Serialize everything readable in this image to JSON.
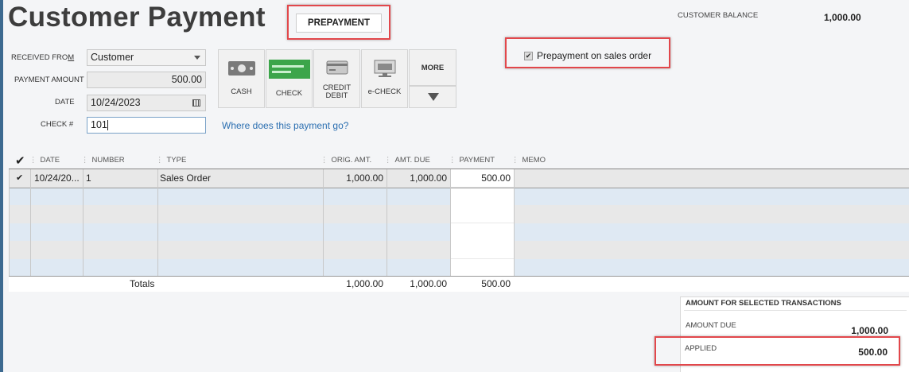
{
  "window": {
    "title": "Customer Payment"
  },
  "prepayment_button": "PREPAYMENT",
  "customer_balance": {
    "label": "CUSTOMER BALANCE",
    "value": "1,000.00"
  },
  "form": {
    "received_from": {
      "label": "RECEIVED FROM",
      "value": "Customer"
    },
    "payment_amount": {
      "label": "PAYMENT AMOUNT",
      "value": "500.00"
    },
    "date": {
      "label": "DATE",
      "value": "10/24/2023"
    },
    "check_no": {
      "label": "CHECK #",
      "value": "101"
    }
  },
  "payment_methods": [
    {
      "label": "CASH",
      "icon": "cash-icon"
    },
    {
      "label": "CHECK",
      "icon": "check-icon"
    },
    {
      "label": "CREDIT DEBIT",
      "icon": "credit-card-icon"
    },
    {
      "label": "e-CHECK",
      "icon": "echeck-icon"
    }
  ],
  "more_button": "MORE",
  "help_link": "Where does this payment go?",
  "prepayment_sales_order": {
    "label": "Prepayment on sales order",
    "checked": true
  },
  "table": {
    "columns": [
      "✔",
      "DATE",
      "NUMBER",
      "TYPE",
      "ORIG. AMT.",
      "AMT. DUE",
      "PAYMENT",
      "MEMO"
    ],
    "rows": [
      {
        "check": "✔",
        "date": "10/24/20...",
        "number": "1",
        "type": "Sales Order",
        "orig_amt": "1,000.00",
        "amt_due": "1,000.00",
        "payment": "500.00",
        "memo": ""
      }
    ],
    "totals": {
      "label": "Totals",
      "orig_amt": "1,000.00",
      "amt_due": "1,000.00",
      "payment": "500.00"
    }
  },
  "summary": {
    "title": "AMOUNT FOR SELECTED TRANSACTIONS",
    "amount_due": {
      "label": "AMOUNT DUE",
      "value": "1,000.00"
    },
    "applied": {
      "label": "APPLIED",
      "value": "500.00"
    }
  },
  "colors": {
    "accent_link": "#2a6eb0",
    "highlight_border": "#e2474b",
    "row_blue": "#dfe9f3",
    "row_gray": "#e8e8e8"
  }
}
